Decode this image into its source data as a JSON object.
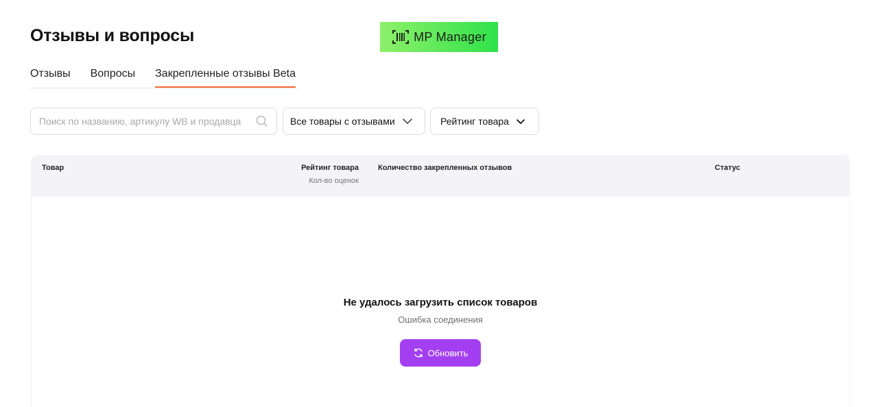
{
  "header": {
    "title": "Отзывы и вопросы"
  },
  "brand": {
    "logo_icon": "barcode-icon",
    "name": "MP Manager",
    "color": "#3be24f"
  },
  "tabs": [
    {
      "label": "Отзывы",
      "active": false
    },
    {
      "label": "Вопросы",
      "active": false
    },
    {
      "label": "Закрепленные отзывы Beta",
      "active": true
    }
  ],
  "filters": {
    "search_placeholder": "Поиск по названию, артикулу WB и продавца",
    "search_value": "",
    "search_icon": "search-icon",
    "products_dropdown": "Все товары с отзывами",
    "rating_dropdown": "Рейтинг товара"
  },
  "table": {
    "columns": {
      "product": "Товар",
      "rating": "Рейтинг товара",
      "rating_sub": "Кол-во оценок",
      "pinned_count": "Количество закрепленных отзывов",
      "status": "Статус"
    }
  },
  "empty_state": {
    "title": "Не удалось загрузить список товаров",
    "subtitle": "Ошибка соединения",
    "button_label": "Обновить",
    "button_icon": "refresh-icon",
    "button_color": "#a33ff0"
  },
  "colors": {
    "tab_active_underline": "#f26a33"
  }
}
